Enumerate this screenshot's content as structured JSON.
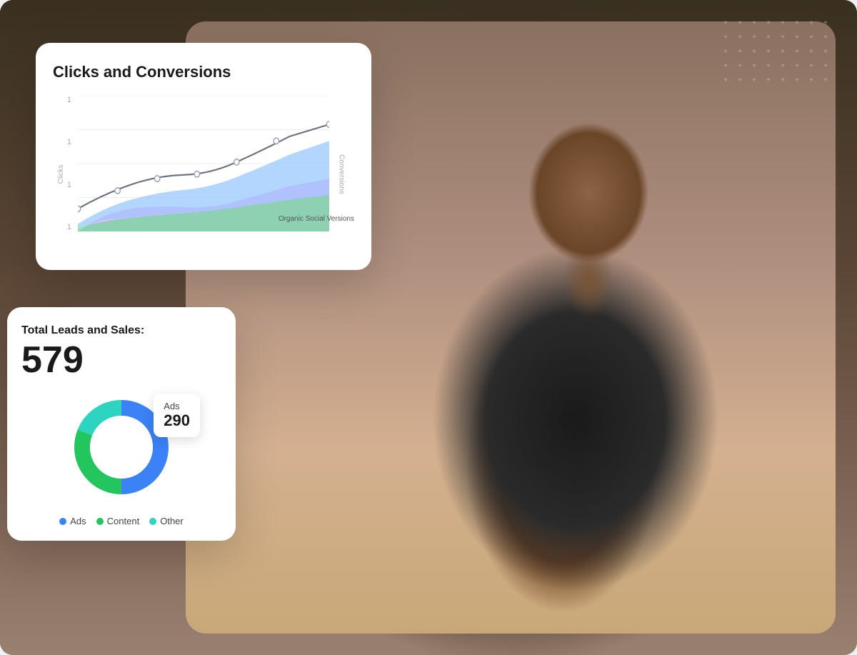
{
  "background": {
    "alt": "Business owner with leather apron in shop"
  },
  "dots_pattern": {
    "symbol": "+"
  },
  "chart_card": {
    "title": "Clicks and Conversions",
    "y_axis_labels": [
      "1",
      "1",
      "1",
      "1"
    ],
    "right_axis_label": "Conversions",
    "left_axis_label": "Clicks",
    "organic_label": "Organic Social\nVersions"
  },
  "leads_card": {
    "title": "Total Leads and Sales:",
    "total": "579",
    "tooltip": {
      "label": "Ads",
      "value": "290"
    },
    "legend": [
      {
        "label": "Ads",
        "color": "#3B82F6"
      },
      {
        "label": "Content",
        "color": "#22C55E"
      },
      {
        "label": "Other",
        "color": "#2DD4BF"
      }
    ],
    "donut_segments": [
      {
        "label": "Ads",
        "value": 290,
        "color": "#3B82F6",
        "percent": 50
      },
      {
        "label": "Content",
        "value": 180,
        "color": "#22C55E",
        "percent": 31
      },
      {
        "label": "Other",
        "value": 109,
        "color": "#2DD4BF",
        "percent": 19
      }
    ]
  }
}
